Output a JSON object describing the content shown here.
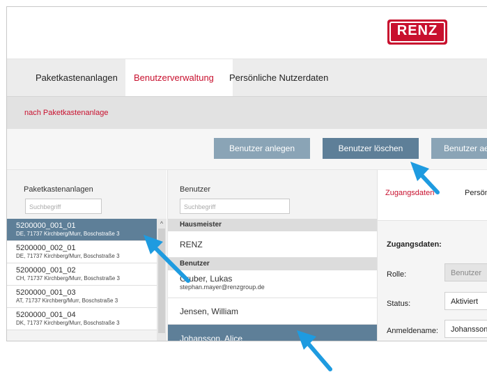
{
  "brand": {
    "logo_text": "RENZ",
    "color": "#c8102e"
  },
  "main_nav": {
    "tabs": [
      {
        "label": "Paketkastenanlagen",
        "active": false
      },
      {
        "label": "Benutzerverwaltung",
        "active": true
      },
      {
        "label": "Persönliche Nutzerdaten",
        "active": false
      }
    ]
  },
  "sub_nav": {
    "link": "nach Paketkastenanlage"
  },
  "actions": {
    "create_label": "Benutzer anlegen",
    "delete_label": "Benutzer löschen",
    "third_label": "Benutzer ae"
  },
  "facilities": {
    "header": "Paketkastenanlagen",
    "search_placeholder": "Suchbegriff",
    "items": [
      {
        "name": "5200000_001_01",
        "address": "DE, 71737 Kirchberg/Murr, Boschstraße 3",
        "selected": true
      },
      {
        "name": "5200000_002_01",
        "address": "DE, 71737 Kirchberg/Murr, Boschstraße 3",
        "selected": false
      },
      {
        "name": "5200000_001_02",
        "address": "CH, 71737 Kirchberg/Murr, Boschstraße 3",
        "selected": false
      },
      {
        "name": "5200000_001_03",
        "address": "AT, 71737 Kirchberg/Murr, Boschstraße 3",
        "selected": false
      },
      {
        "name": "5200000_001_04",
        "address": "DK, 71737 Kirchberg/Murr, Boschstraße 3",
        "selected": false
      }
    ]
  },
  "users": {
    "header": "Benutzer",
    "search_placeholder": "Suchbegriff",
    "group_caretaker": "Hausmeister",
    "caretaker_name": "RENZ",
    "group_users": "Benutzer",
    "items": [
      {
        "name": "Gruber, Lukas",
        "email": "stephan.mayer@renzgroup.de",
        "selected": false
      },
      {
        "name": "Jensen, William",
        "selected": false
      },
      {
        "name": "Johansson, Alice",
        "selected": true
      }
    ]
  },
  "detail": {
    "tab_access": "Zugangsdaten",
    "tab_personal": "Persön",
    "section_title": "Zugangsdaten:",
    "rows": [
      {
        "label": "Rolle:",
        "value": "Benutzer"
      },
      {
        "label": "Status:",
        "value": "Aktiviert"
      },
      {
        "label": "Anmeldename:",
        "value": "Johansson"
      }
    ]
  },
  "colors": {
    "accent": "#c8102e",
    "selected": "#5e7f98",
    "button_light": "#8aa4b6",
    "pointer": "#1e9be0"
  }
}
